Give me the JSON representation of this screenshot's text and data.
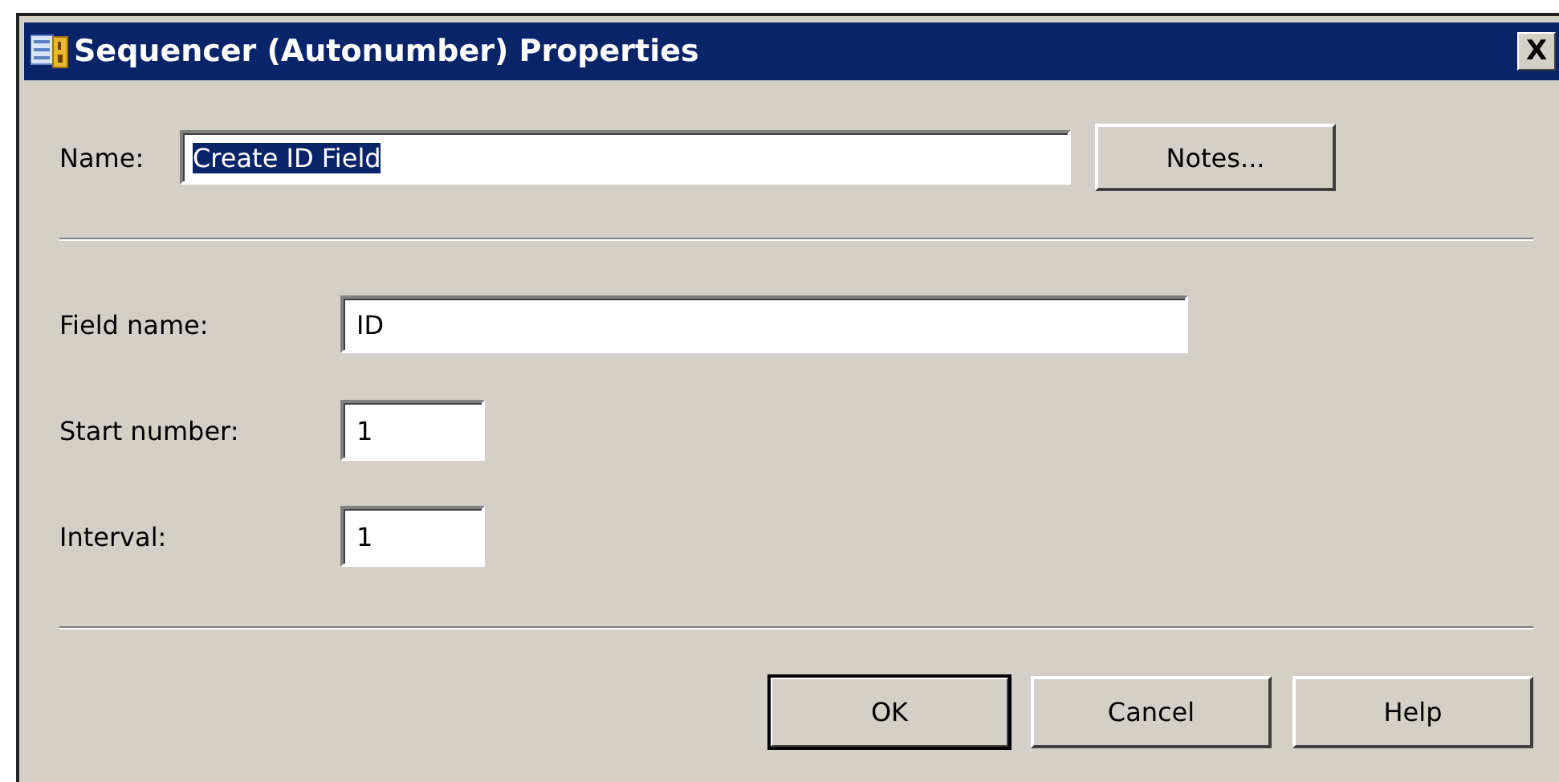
{
  "window": {
    "title": "Sequencer (Autonumber) Properties",
    "close": "X"
  },
  "name_row": {
    "label": "Name:",
    "value": "Create ID Field",
    "text_selected": true,
    "button": "Notes..."
  },
  "fields": [
    {
      "label": "Field name:",
      "value": "ID",
      "kind": "wide"
    },
    {
      "label": "Start number:",
      "value": "1",
      "kind": "short"
    },
    {
      "label": "Interval:",
      "value": "1",
      "kind": "short"
    }
  ],
  "buttons": [
    {
      "label": "OK",
      "default": true
    },
    {
      "label": "Cancel",
      "default": false
    },
    {
      "label": "Help",
      "default": false
    }
  ]
}
